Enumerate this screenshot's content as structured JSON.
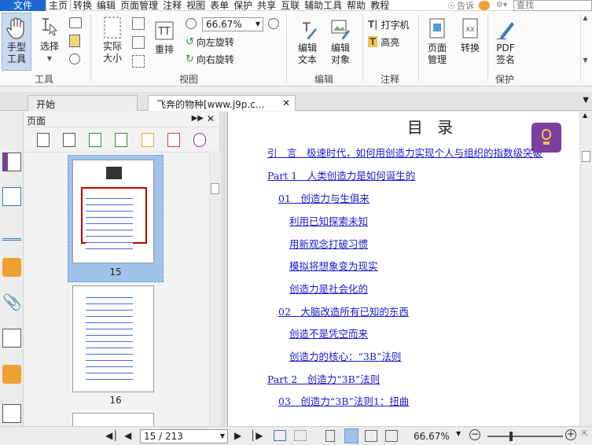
{
  "menu": {
    "file": "文件",
    "items": [
      "主页",
      "转换",
      "编辑",
      "页面管理",
      "注释",
      "视图",
      "表单",
      "保护",
      "共享",
      "互联",
      "辅助工具",
      "帮助",
      "教程"
    ],
    "tell": "告诉",
    "search_placeholder": "查找"
  },
  "ribbon": {
    "hand": "手型\n工具",
    "select": "选择",
    "actual_size": "实际\n大小",
    "reflow": "重排",
    "zoom": "66.67%",
    "rotate_left": "向左旋转",
    "rotate_right": "向右旋转",
    "edit_text": "编辑\n文本",
    "edit_object": "编辑\n对象",
    "typewriter": "打字机",
    "highlight": "高亮",
    "page_manage": "页面\n管理",
    "convert": "转换",
    "pdf_sign": "PDF\n签名",
    "groups": {
      "tools": "工具",
      "view": "视图",
      "edit": "编辑",
      "annot": "注释",
      "protect": "保护"
    }
  },
  "tabs": [
    {
      "label": "开始"
    },
    {
      "label": "飞奔的物种[www.j9p.c..."
    }
  ],
  "panel": {
    "title": "页面"
  },
  "thumbnails": [
    {
      "page": "15"
    },
    {
      "page": "16"
    }
  ],
  "toc": {
    "title": "目 录",
    "entries": [
      "引　言　极速时代，如何用创造力实现个人与组织的指数级突破",
      "Part 1　人类创造力是如何诞生的",
      "01　创造力与生俱来",
      "利用已知探索未知",
      "用新观念打破习惯",
      "模拟将想象变为现实",
      "创造力是社会化的",
      "02　大脑改造所有已知的东西",
      "创造不是凭空而来",
      "创造力的核心：“3B”法则",
      "Part 2　创造力“3B”法则",
      "03　创造力“3B”法则1：扭曲"
    ]
  },
  "status": {
    "page": "15 / 213",
    "zoom": "66.67%"
  }
}
